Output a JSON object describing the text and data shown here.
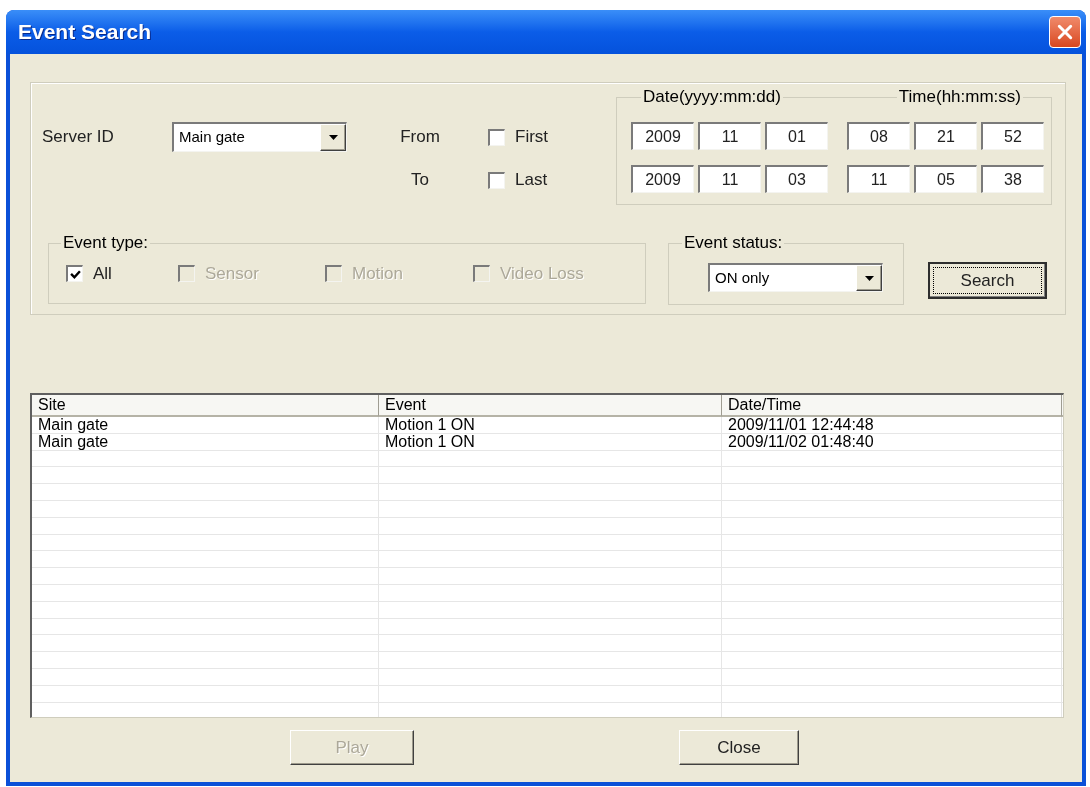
{
  "window": {
    "title": "Event Search"
  },
  "server": {
    "label": "Server ID",
    "value": "Main gate"
  },
  "range": [
    {
      "label": "From",
      "option": "First",
      "checked": false
    },
    {
      "label": "To",
      "option": "Last",
      "checked": false
    }
  ],
  "date_time": {
    "date_label": "Date(yyyy:mm:dd)",
    "time_label": "Time(hh:mm:ss)",
    "rows": [
      {
        "date": [
          "2009",
          "11",
          "01"
        ],
        "time": [
          "08",
          "21",
          "52"
        ]
      },
      {
        "date": [
          "2009",
          "11",
          "03"
        ],
        "time": [
          "11",
          "05",
          "38"
        ]
      }
    ]
  },
  "event_type": {
    "label": "Event type:",
    "options": [
      {
        "label": "All",
        "checked": true,
        "disabled": false
      },
      {
        "label": "Sensor",
        "checked": false,
        "disabled": true
      },
      {
        "label": "Motion",
        "checked": false,
        "disabled": true
      },
      {
        "label": "Video Loss",
        "checked": false,
        "disabled": true
      }
    ]
  },
  "event_status": {
    "label": "Event status:",
    "value": "ON only"
  },
  "search_button": {
    "label": "Search",
    "focused": true
  },
  "table": {
    "columns": [
      "Site",
      "Event",
      "Date/Time"
    ],
    "rows": [
      [
        "Main gate",
        "Motion 1 ON",
        "2009/11/01 12:44:48"
      ],
      [
        "Main gate",
        "Motion 1 ON",
        "2009/11/02 01:48:40"
      ]
    ]
  },
  "buttons": [
    {
      "label": "Play",
      "disabled": true
    },
    {
      "label": "Close",
      "disabled": false
    }
  ]
}
